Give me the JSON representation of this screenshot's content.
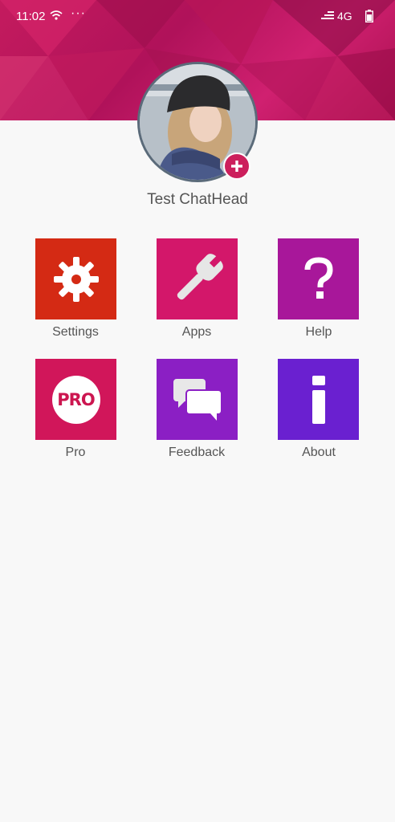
{
  "status_bar": {
    "time": "11:02",
    "dots": "···",
    "network": "4G"
  },
  "profile": {
    "name": "Test ChatHead"
  },
  "menu": [
    {
      "label": "Settings",
      "color": "#d42a14",
      "icon": "gear-icon"
    },
    {
      "label": "Apps",
      "color": "#d3176a",
      "icon": "wrench-icon"
    },
    {
      "label": "Help",
      "color": "#a8179a",
      "icon": "question-icon"
    },
    {
      "label": "Pro",
      "color": "#d1165a",
      "icon": "pro-badge-icon",
      "badge_text": "PRO"
    },
    {
      "label": "Feedback",
      "color": "#8b1fc4",
      "icon": "chat-bubbles-icon"
    },
    {
      "label": "About",
      "color": "#6a20d0",
      "icon": "info-icon"
    }
  ],
  "colors": {
    "header": "#c41b5e",
    "accent": "#cc1f5c",
    "background": "#f8f8f8"
  }
}
